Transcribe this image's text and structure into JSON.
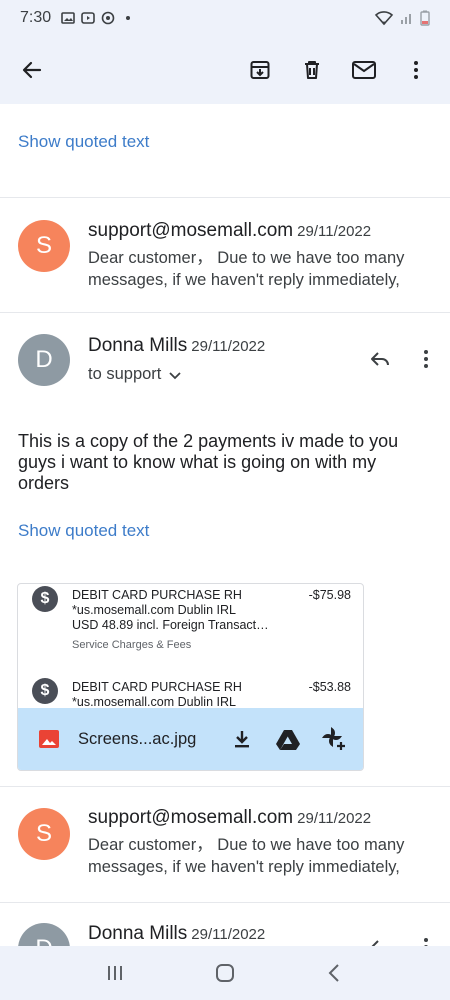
{
  "status_bar": {
    "time": "7:30"
  },
  "thread": {
    "top_show_quoted": "Show quoted text",
    "messages": [
      {
        "avatar_letter": "S",
        "sender": "support@mosemall.com",
        "date": "29/11/2022",
        "snippet": "Dear customer， Due to we have too many messages, if we haven't reply immediately,"
      },
      {
        "avatar_letter": "D",
        "sender": "Donna Mills",
        "date": "29/11/2022",
        "recipient": "to support",
        "body": "This is a copy of the 2 payments iv made to you guys i want to know what is going on with my orders",
        "show_quoted": "Show quoted text",
        "attachment": {
          "transactions": [
            {
              "line1": "DEBIT CARD PURCHASE RH",
              "line2": "*us.mosemall.com Dublin IRL",
              "line3": "USD 48.89 incl. Foreign Transact…",
              "category": "Service Charges & Fees",
              "amount": "-$75.98"
            },
            {
              "line1": "DEBIT CARD PURCHASE RH",
              "line2": "*us.mosemall.com Dublin IRL",
              "amount": "-$53.88"
            }
          ],
          "file_name": "Screens...ac.jpg"
        }
      },
      {
        "avatar_letter": "S",
        "sender": "support@mosemall.com",
        "date": "29/11/2022",
        "snippet": "Dear customer， Due to we have too many messages, if we haven't reply immediately,"
      },
      {
        "avatar_letter": "D",
        "sender": "Donna Mills",
        "date": "29/11/2022"
      }
    ]
  },
  "colors": {
    "accent_link": "#3d7cc9",
    "avatar_support": "#f6845c",
    "avatar_donna": "#8e9aa3",
    "attachment_bar": "#c3e2fa",
    "app_bar": "#eef2fa"
  },
  "icons": {
    "app_bar": [
      "back-arrow-icon",
      "archive-icon",
      "delete-icon",
      "mark-unread-icon",
      "more-vert-icon"
    ],
    "message": [
      "reply-icon",
      "more-vert-icon",
      "chevron-down-icon"
    ],
    "attachment": [
      "image-icon",
      "download-icon",
      "drive-icon",
      "photos-add-icon"
    ],
    "nav": [
      "recents-icon",
      "home-icon",
      "back-icon"
    ]
  }
}
